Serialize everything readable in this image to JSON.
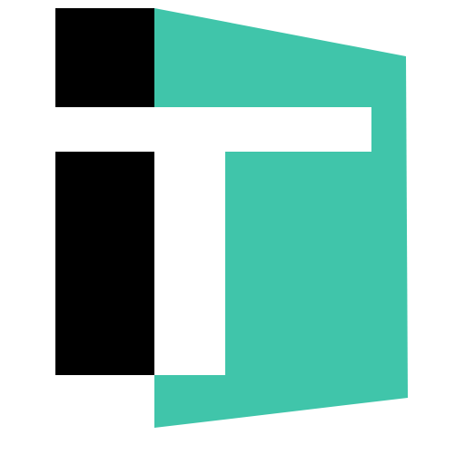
{
  "logo": {
    "icon": "it-letter-logo-icon",
    "colors": {
      "background": "#ffffff",
      "accent": "#40c5aa",
      "dark": "#000000",
      "letter": "#ffffff"
    }
  }
}
